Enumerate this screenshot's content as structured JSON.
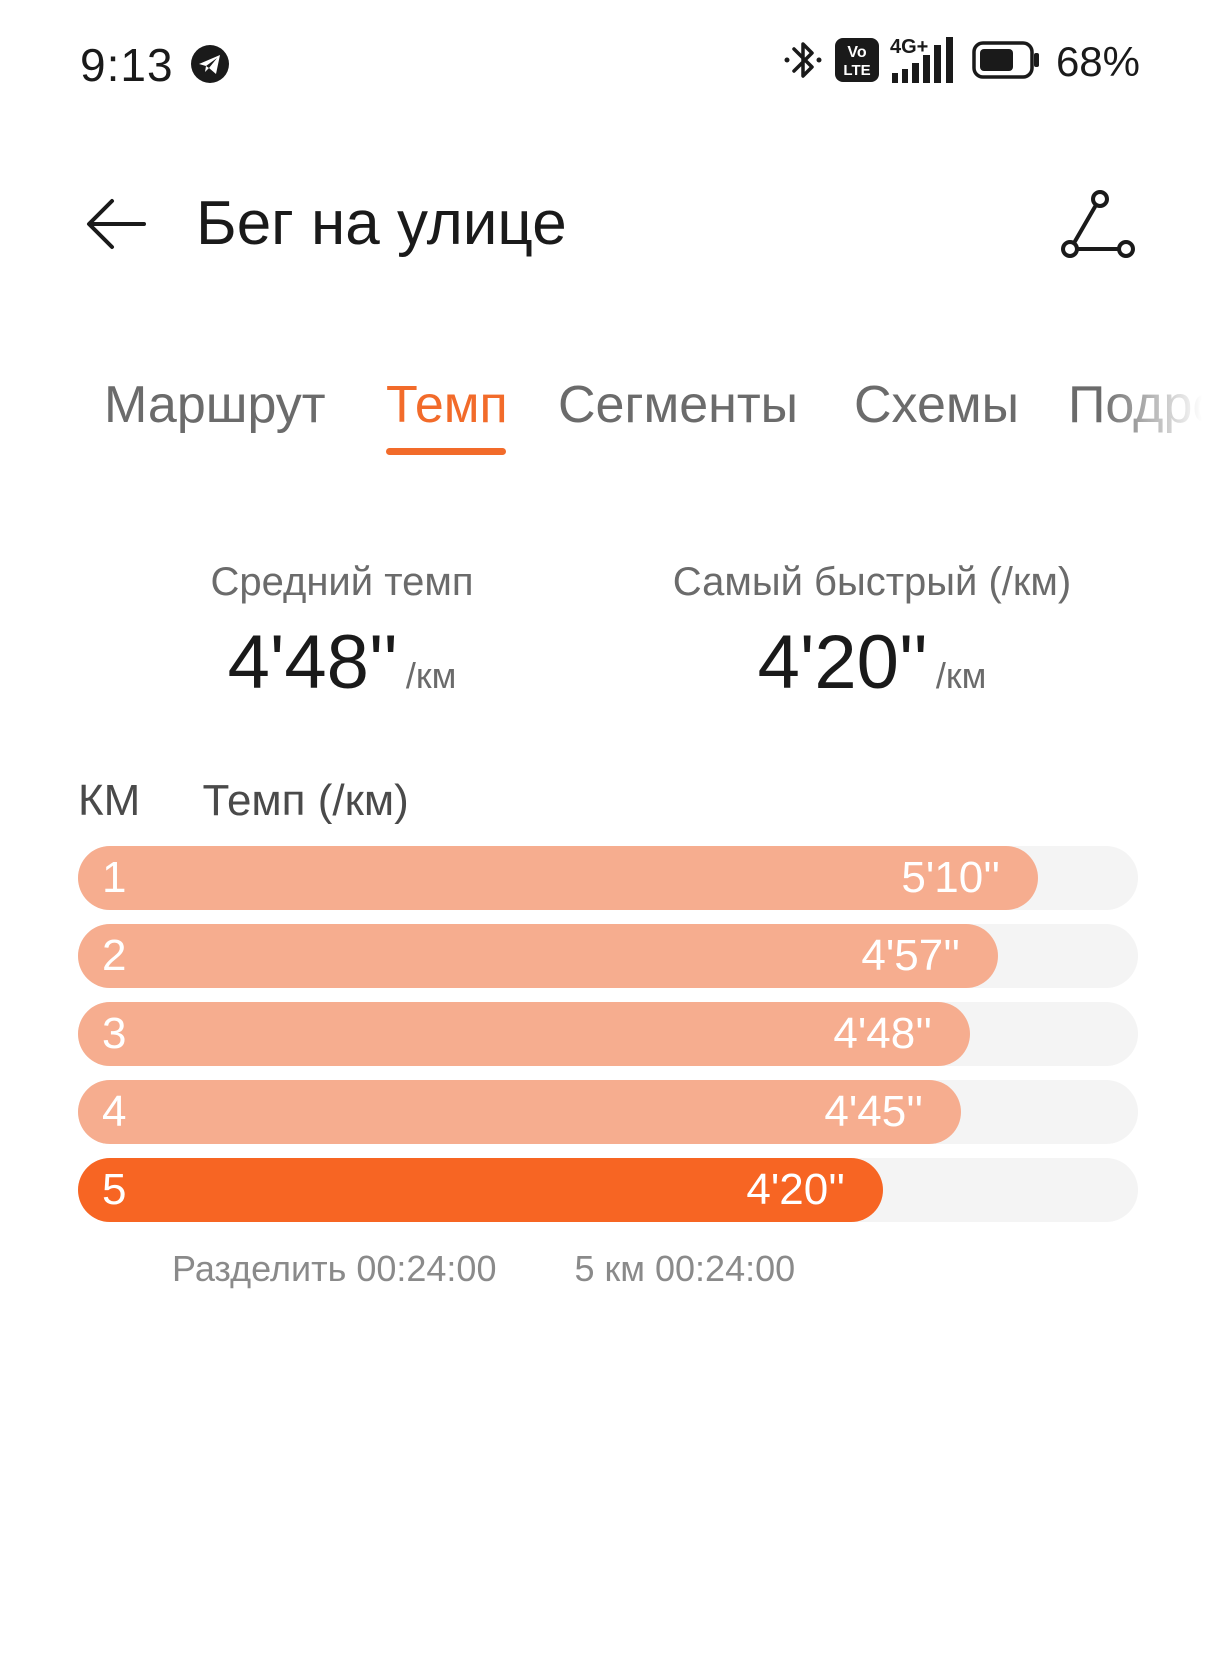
{
  "status_bar": {
    "time": "9:13",
    "battery_percent": "68%",
    "battery_level": 0.68,
    "network_label": "4G+",
    "volte_label_top": "Vo",
    "volte_label_bottom": "LTE",
    "icons": [
      "telegram-icon",
      "bluetooth-icon",
      "volte-icon",
      "signal-icon",
      "battery-icon"
    ]
  },
  "header": {
    "title": "Бег на улице",
    "back_icon": "arrow-left-icon",
    "route_icon": "route-icon"
  },
  "tabs": [
    {
      "label": "Маршрут",
      "active": false
    },
    {
      "label": "Темп",
      "active": true
    },
    {
      "label": "Сегменты",
      "active": false
    },
    {
      "label": "Схемы",
      "active": false
    },
    {
      "label": "Подробно",
      "active": false
    }
  ],
  "summary": {
    "average": {
      "label": "Средний темп",
      "value": "4'48''",
      "unit": "/км"
    },
    "fastest": {
      "label": "Самый быстрый (/км)",
      "value": "4'20''",
      "unit": "/км"
    }
  },
  "pace_table": {
    "col_km": "КМ",
    "col_pace": "Темп (/км)",
    "rows": [
      {
        "km": "1",
        "pace": "5'10''",
        "seconds": 310,
        "fastest": false
      },
      {
        "km": "2",
        "pace": "4'57''",
        "seconds": 297,
        "fastest": false
      },
      {
        "km": "3",
        "pace": "4'48''",
        "seconds": 288,
        "fastest": false
      },
      {
        "km": "4",
        "pace": "4'45''",
        "seconds": 285,
        "fastest": false
      },
      {
        "km": "5",
        "pace": "4'20''",
        "seconds": 260,
        "fastest": true
      }
    ],
    "footer_split": "Разделить 00:24:00",
    "footer_total": "5 км 00:24:00"
  },
  "colors": {
    "accent": "#f26b2a",
    "bar_normal": "#f6ad8f",
    "bar_fastest": "#f76523",
    "track": "#f4f4f4"
  }
}
